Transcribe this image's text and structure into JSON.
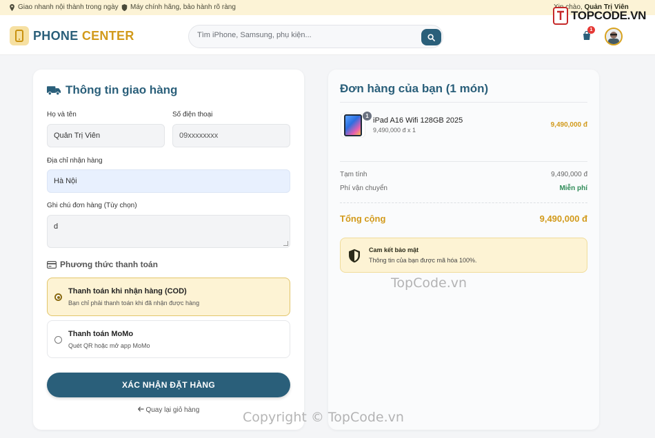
{
  "topbar": {
    "delivery": "Giao nhanh nội thành trong ngày",
    "warranty": "Máy chính hãng, bảo hành rõ ràng",
    "greeting_prefix": "Xin chào, ",
    "user_name": "Quản Trị Viên"
  },
  "header": {
    "logo_part1": "PHONE",
    "logo_part2": "CENTER",
    "search_placeholder": "Tìm iPhone, Samsung, phụ kiện...",
    "cart_count": "1",
    "brand_badge": "TOPCODE.VN"
  },
  "shipping": {
    "title": "Thông tin giao hàng",
    "name_label": "Họ và tên",
    "name_value": "Quản Trị Viên",
    "phone_label": "Số điện thoại",
    "phone_value": "09xxxxxxxx",
    "address_label": "Địa chỉ nhận hàng",
    "address_value": "Hà Nội",
    "note_label": "Ghi chú đơn hàng (Tùy chọn)",
    "note_value": "d",
    "payment_title": "Phương thức thanh toán",
    "payment_options": [
      {
        "title": "Thanh toán khi nhận hàng (COD)",
        "desc": "Bạn chỉ phải thanh toán khi đã nhận được hàng",
        "selected": true
      },
      {
        "title": "Thanh toán MoMo",
        "desc": "Quét QR hoặc mở app MoMo",
        "selected": false
      }
    ],
    "submit_label": "XÁC NHẬN ĐẶT HÀNG",
    "back_label": "Quay lại giỏ hàng"
  },
  "order": {
    "title": "Đơn hàng của bạn (1 món)",
    "items": [
      {
        "name": "iPad A16 Wifi 128GB 2025",
        "qty_line": "9,490,000 đ x 1",
        "qty_badge": "1",
        "price": "9,490,000 đ"
      }
    ],
    "subtotal_label": "Tạm tính",
    "subtotal_value": "9,490,000 đ",
    "shipping_label": "Phí vận chuyển",
    "shipping_value": "Miễn phí",
    "total_label": "Tổng cộng",
    "total_value": "9,490,000 đ",
    "secure_title": "Cam kết bảo mật",
    "secure_desc": "Thông tin của bạn được mã hóa 100%."
  },
  "watermarks": {
    "mid": "TopCode.vn",
    "bottom": "Copyright © TopCode.vn"
  },
  "colors": {
    "primary": "#2a5f7a",
    "accent": "#d29a1b",
    "topbar_bg": "#fcf3d6",
    "free_green": "#2e8b57"
  },
  "icons": {
    "location": "map-pin-icon",
    "shield": "shield-icon",
    "truck": "truck-icon",
    "card": "credit-card-icon",
    "search": "search-icon",
    "cart": "shopping-bag-icon",
    "back": "arrow-left-icon"
  }
}
